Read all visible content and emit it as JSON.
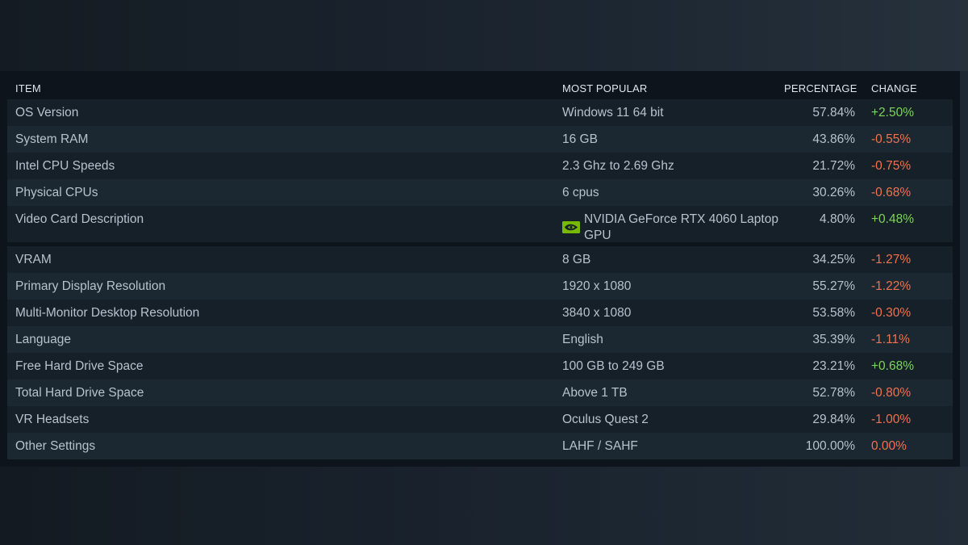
{
  "table": {
    "headers": {
      "item": "ITEM",
      "most_popular": "MOST POPULAR",
      "percentage": "PERCENTAGE",
      "change": "CHANGE"
    },
    "rows": [
      {
        "item": "OS Version",
        "popular": "Windows 11 64 bit",
        "percentage": "57.84%",
        "change": "+2.50%",
        "trend": "up"
      },
      {
        "item": "System RAM",
        "popular": "16 GB",
        "percentage": "43.86%",
        "change": "-0.55%",
        "trend": "down"
      },
      {
        "item": "Intel CPU Speeds",
        "popular": "2.3 Ghz to 2.69 Ghz",
        "percentage": "21.72%",
        "change": "-0.75%",
        "trend": "down"
      },
      {
        "item": "Physical CPUs",
        "popular": "6 cpus",
        "percentage": "30.26%",
        "change": "-0.68%",
        "trend": "down"
      },
      {
        "item": "Video Card Description",
        "popular": "NVIDIA GeForce RTX 4060 Laptop GPU",
        "popular_icon": "nvidia-logo-icon",
        "percentage": "4.80%",
        "change": "+0.48%",
        "trend": "up"
      },
      {
        "item": "VRAM",
        "popular": "8 GB",
        "percentage": "34.25%",
        "change": "-1.27%",
        "trend": "down"
      },
      {
        "item": "Primary Display Resolution",
        "popular": "1920 x 1080",
        "percentage": "55.27%",
        "change": "-1.22%",
        "trend": "down"
      },
      {
        "item": "Multi-Monitor Desktop Resolution",
        "popular": "3840 x 1080",
        "percentage": "53.58%",
        "change": "-0.30%",
        "trend": "down"
      },
      {
        "item": "Language",
        "popular": "English",
        "percentage": "35.39%",
        "change": "-1.11%",
        "trend": "down"
      },
      {
        "item": "Free Hard Drive Space",
        "popular": "100 GB to 249 GB",
        "percentage": "23.21%",
        "change": "+0.68%",
        "trend": "up"
      },
      {
        "item": "Total Hard Drive Space",
        "popular": "Above 1 TB",
        "percentage": "52.78%",
        "change": "-0.80%",
        "trend": "down"
      },
      {
        "item": "VR Headsets",
        "popular": "Oculus Quest 2",
        "percentage": "29.84%",
        "change": "-1.00%",
        "trend": "down"
      },
      {
        "item": "Other Settings",
        "popular": "LAHF / SAHF",
        "percentage": "100.00%",
        "change": "0.00%",
        "trend": "flat"
      }
    ]
  },
  "colors": {
    "positive": "#7fd45a",
    "negative": "#f0724e",
    "header_text": "#dfe6ee",
    "row_text": "#b8c2cc",
    "nvidia_green": "#76b900"
  }
}
